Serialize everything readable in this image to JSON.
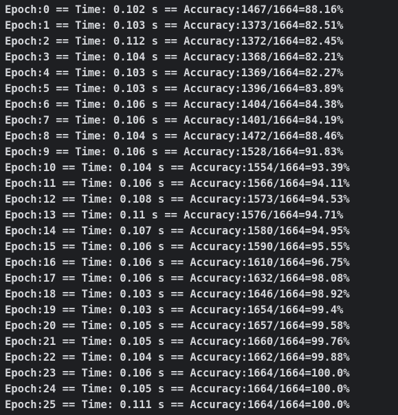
{
  "terminal": {
    "lines": [
      "Epoch:0 == Time: 0.102 s == Accuracy:1467/1664=88.16%",
      "Epoch:1 == Time: 0.103 s == Accuracy:1373/1664=82.51%",
      "Epoch:2 == Time: 0.112 s == Accuracy:1372/1664=82.45%",
      "Epoch:3 == Time: 0.104 s == Accuracy:1368/1664=82.21%",
      "Epoch:4 == Time: 0.103 s == Accuracy:1369/1664=82.27%",
      "Epoch:5 == Time: 0.103 s == Accuracy:1396/1664=83.89%",
      "Epoch:6 == Time: 0.106 s == Accuracy:1404/1664=84.38%",
      "Epoch:7 == Time: 0.106 s == Accuracy:1401/1664=84.19%",
      "Epoch:8 == Time: 0.104 s == Accuracy:1472/1664=88.46%",
      "Epoch:9 == Time: 0.106 s == Accuracy:1528/1664=91.83%",
      "Epoch:10 == Time: 0.104 s == Accuracy:1554/1664=93.39%",
      "Epoch:11 == Time: 0.106 s == Accuracy:1566/1664=94.11%",
      "Epoch:12 == Time: 0.108 s == Accuracy:1573/1664=94.53%",
      "Epoch:13 == Time: 0.11 s == Accuracy:1576/1664=94.71%",
      "Epoch:14 == Time: 0.107 s == Accuracy:1580/1664=94.95%",
      "Epoch:15 == Time: 0.106 s == Accuracy:1590/1664=95.55%",
      "Epoch:16 == Time: 0.106 s == Accuracy:1610/1664=96.75%",
      "Epoch:17 == Time: 0.106 s == Accuracy:1632/1664=98.08%",
      "Epoch:18 == Time: 0.103 s == Accuracy:1646/1664=98.92%",
      "Epoch:19 == Time: 0.103 s == Accuracy:1654/1664=99.4%",
      "Epoch:20 == Time: 0.105 s == Accuracy:1657/1664=99.58%",
      "Epoch:21 == Time: 0.105 s == Accuracy:1660/1664=99.76%",
      "Epoch:22 == Time: 0.104 s == Accuracy:1662/1664=99.88%",
      "Epoch:23 == Time: 0.106 s == Accuracy:1664/1664=100.0%",
      "Epoch:24 == Time: 0.105 s == Accuracy:1664/1664=100.0%",
      "Epoch:25 == Time: 0.111 s == Accuracy:1664/1664=100.0%"
    ],
    "colors": {
      "background": "#1e1f22",
      "text": "#d4d6da"
    }
  }
}
